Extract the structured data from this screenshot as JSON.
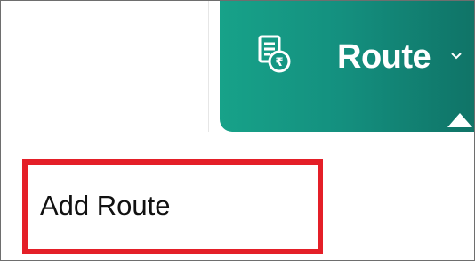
{
  "nav": {
    "route_label": "Route",
    "route_icon": "rupee-receipt-icon",
    "chevron_icon": "chevron-down-icon",
    "accent_gradient": [
      "#17a289",
      "#0f7165"
    ]
  },
  "menu": {
    "items": [
      {
        "label": "Add Route"
      }
    ]
  },
  "highlight": {
    "color": "#e41f28"
  }
}
